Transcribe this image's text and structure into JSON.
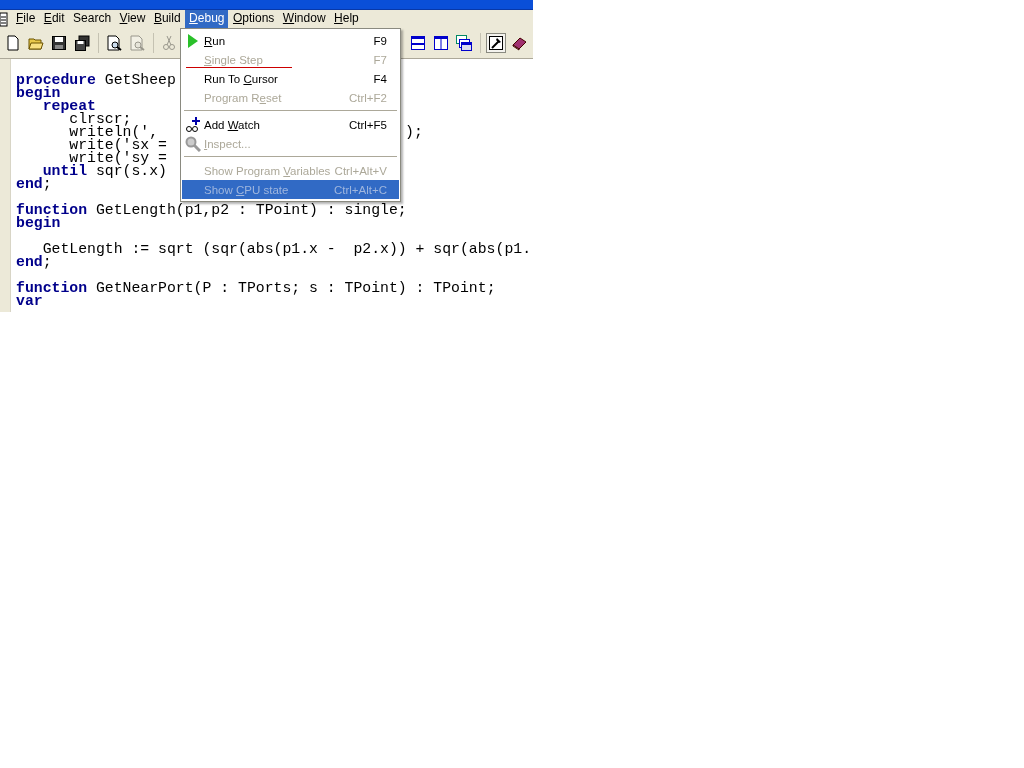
{
  "menu_bar": [
    {
      "label": "File",
      "selected": false
    },
    {
      "label": "Edit",
      "selected": false
    },
    {
      "label": "Search",
      "selected": false
    },
    {
      "label": "View",
      "selected": false
    },
    {
      "label": "Build",
      "selected": false
    },
    {
      "label": "Debug",
      "selected": true
    },
    {
      "label": "Options",
      "selected": false
    },
    {
      "label": "Window",
      "selected": false
    },
    {
      "label": "Help",
      "selected": false
    }
  ],
  "toolbar": [
    {
      "kind": "new",
      "disabled": false
    },
    {
      "kind": "open",
      "disabled": false
    },
    {
      "kind": "save",
      "disabled": false
    },
    {
      "kind": "saveall",
      "disabled": false
    },
    {
      "kind": "sep"
    },
    {
      "kind": "preview",
      "disabled": false
    },
    {
      "kind": "preview",
      "disabled": true
    },
    {
      "kind": "sep"
    },
    {
      "kind": "cut",
      "disabled": true
    },
    {
      "kind": "gap"
    },
    {
      "kind": "tileh",
      "disabled": false
    },
    {
      "kind": "tilev",
      "disabled": false
    },
    {
      "kind": "cascade",
      "disabled": false
    },
    {
      "kind": "sep"
    },
    {
      "kind": "tool",
      "disabled": false,
      "pressed": true
    },
    {
      "kind": "book",
      "disabled": false
    }
  ],
  "debug_menu": [
    {
      "kind": "item",
      "label": "Run",
      "shortcut": "F9",
      "disabled": false,
      "selected": false
    },
    {
      "kind": "item",
      "label": "Single Step",
      "shortcut": "F7",
      "disabled": true,
      "selected": false,
      "marked": true
    },
    {
      "kind": "item",
      "label": "Run To Cursor",
      "shortcut": "F4",
      "disabled": false,
      "selected": false
    },
    {
      "kind": "item",
      "label": "Program Reset",
      "shortcut": "Ctrl+F2",
      "disabled": true,
      "selected": false
    },
    {
      "kind": "separator"
    },
    {
      "kind": "item",
      "label": "Add Watch",
      "shortcut": "Ctrl+F5",
      "disabled": false,
      "selected": false
    },
    {
      "kind": "item",
      "label": "Inspect...",
      "disabled": true,
      "selected": false
    },
    {
      "kind": "separator"
    },
    {
      "kind": "item",
      "label": "Show Program Variables",
      "shortcut": "Ctrl+Alt+V",
      "disabled": true,
      "selected": false
    },
    {
      "kind": "item",
      "label": "Show CPU state",
      "shortcut": "Ctrl+Alt+C",
      "disabled": true,
      "selected": true
    }
  ],
  "editor": {
    "lines": [
      {
        "kind": "code",
        "tokens": [
          {
            "kind": "keyword",
            "text": "procedure"
          },
          {
            "kind": "plain",
            "text": " GetSheep"
          }
        ]
      },
      {
        "kind": "code",
        "tokens": [
          {
            "kind": "keyword",
            "text": "begin"
          }
        ]
      },
      {
        "kind": "code",
        "tokens": [
          {
            "kind": "keyword",
            "text": "   repeat"
          }
        ]
      },
      {
        "kind": "code",
        "tokens": [
          {
            "kind": "plain",
            "text": "      clrscr;"
          }
        ]
      },
      {
        "kind": "code",
        "tokens": [
          {
            "kind": "plain",
            "text": "      writeln(',"
          }
        ],
        "tail": ");"
      },
      {
        "kind": "code",
        "tokens": [
          {
            "kind": "plain",
            "text": "      write('sx ="
          }
        ]
      },
      {
        "kind": "code",
        "tokens": [
          {
            "kind": "plain",
            "text": "      write('sy ="
          }
        ]
      },
      {
        "kind": "code",
        "tokens": [
          {
            "kind": "keyword",
            "text": "   until"
          },
          {
            "kind": "plain",
            "text": " sqr(s.x)"
          }
        ]
      },
      {
        "kind": "code",
        "tokens": [
          {
            "kind": "keyword",
            "text": "end"
          },
          {
            "kind": "plain",
            "text": ";"
          }
        ]
      },
      {
        "kind": "blank"
      },
      {
        "kind": "code",
        "tokens": [
          {
            "kind": "keyword",
            "text": "function"
          },
          {
            "kind": "plain",
            "text": " GetLength(p1,p2 : TPoint) : single;"
          }
        ]
      },
      {
        "kind": "code",
        "tokens": [
          {
            "kind": "keyword",
            "text": "begin"
          }
        ]
      },
      {
        "kind": "blank"
      },
      {
        "kind": "code",
        "tokens": [
          {
            "kind": "plain",
            "text": "   GetLength := sqrt (sqr(abs(p1.x -  p2.x)) + sqr(abs(p1."
          }
        ]
      },
      {
        "kind": "code",
        "tokens": [
          {
            "kind": "keyword",
            "text": "end"
          },
          {
            "kind": "plain",
            "text": ";"
          }
        ]
      },
      {
        "kind": "blank"
      },
      {
        "kind": "code",
        "tokens": [
          {
            "kind": "keyword",
            "text": "function"
          },
          {
            "kind": "plain",
            "text": " GetNearPort(P : TPorts; s : TPoint) : TPoint;"
          }
        ]
      },
      {
        "kind": "code",
        "tokens": [
          {
            "kind": "keyword",
            "text": "var"
          }
        ]
      }
    ]
  }
}
